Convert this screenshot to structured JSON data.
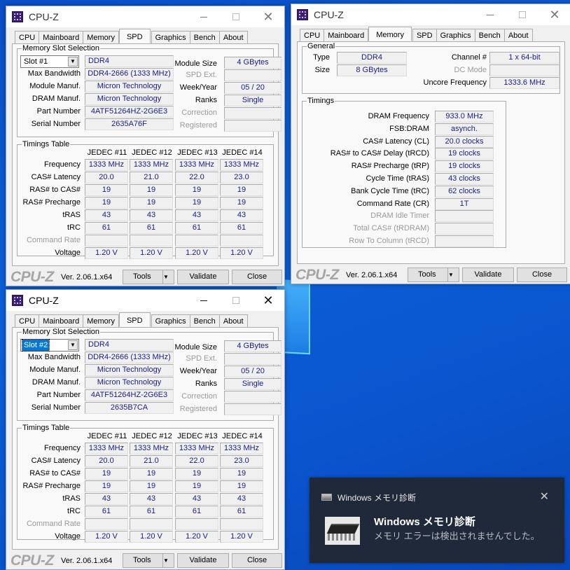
{
  "desktop": {
    "background_color": "#0b55cf"
  },
  "windows": [
    {
      "id": "spd1",
      "title": "CPU-Z",
      "active": false,
      "tabs": [
        "CPU",
        "Mainboard",
        "Memory",
        "SPD",
        "Graphics",
        "Bench",
        "About"
      ],
      "selected_tab": "SPD",
      "slot_group_label": "Memory Slot Selection",
      "slot": "Slot #1",
      "type": "DDR4",
      "labels": {
        "max_bandwidth": "Max Bandwidth",
        "module_manuf": "Module Manuf.",
        "dram_manuf": "DRAM Manuf.",
        "part_number": "Part Number",
        "serial_number": "Serial Number",
        "module_size": "Module Size",
        "spd_ext": "SPD Ext.",
        "week_year": "Week/Year",
        "ranks": "Ranks",
        "correction": "Correction",
        "registered": "Registered"
      },
      "values": {
        "max_bandwidth": "DDR4-2666 (1333 MHz)",
        "module_manuf": "Micron Technology",
        "dram_manuf": "Micron Technology",
        "part_number": "4ATF51264HZ-2G6E3",
        "serial_number": "2635A76F",
        "module_size": "4 GBytes",
        "spd_ext": "",
        "week_year": "05 / 20",
        "ranks": "Single",
        "correction": "",
        "registered": ""
      },
      "timings": {
        "group_label": "Timings Table",
        "columns": [
          "JEDEC #11",
          "JEDEC #12",
          "JEDEC #13",
          "JEDEC #14"
        ],
        "rows": [
          {
            "label": "Frequency",
            "dim": false,
            "values": [
              "1333 MHz",
              "1333 MHz",
              "1333 MHz",
              "1333 MHz"
            ]
          },
          {
            "label": "CAS# Latency",
            "dim": false,
            "values": [
              "20.0",
              "21.0",
              "22.0",
              "23.0"
            ]
          },
          {
            "label": "RAS# to CAS#",
            "dim": false,
            "values": [
              "19",
              "19",
              "19",
              "19"
            ]
          },
          {
            "label": "RAS# Precharge",
            "dim": false,
            "values": [
              "19",
              "19",
              "19",
              "19"
            ]
          },
          {
            "label": "tRAS",
            "dim": false,
            "values": [
              "43",
              "43",
              "43",
              "43"
            ]
          },
          {
            "label": "tRC",
            "dim": false,
            "values": [
              "61",
              "61",
              "61",
              "61"
            ]
          },
          {
            "label": "Command Rate",
            "dim": true,
            "values": [
              "",
              "",
              "",
              ""
            ]
          },
          {
            "label": "Voltage",
            "dim": false,
            "values": [
              "1.20 V",
              "1.20 V",
              "1.20 V",
              "1.20 V"
            ]
          }
        ]
      },
      "footer": {
        "brand": "CPU-Z",
        "version": "Ver. 2.06.1.x64",
        "tools": "Tools",
        "validate": "Validate",
        "close": "Close"
      }
    },
    {
      "id": "mem",
      "title": "CPU-Z",
      "active": false,
      "tabs": [
        "CPU",
        "Mainboard",
        "Memory",
        "SPD",
        "Graphics",
        "Bench",
        "About"
      ],
      "selected_tab": "Memory",
      "general": {
        "group_label": "General",
        "type_label": "Type",
        "type": "DDR4",
        "size_label": "Size",
        "size": "8 GBytes",
        "channel_label": "Channel #",
        "channel": "1 x 64-bit",
        "dc_mode_label": "DC Mode",
        "dc_mode": "",
        "uncore_label": "Uncore Frequency",
        "uncore": "1333.6 MHz"
      },
      "timings": {
        "group_label": "Timings",
        "rows": [
          {
            "label": "DRAM Frequency",
            "dim": false,
            "value": "933.0 MHz"
          },
          {
            "label": "FSB:DRAM",
            "dim": false,
            "value": "asynch."
          },
          {
            "label": "CAS# Latency (CL)",
            "dim": false,
            "value": "20.0 clocks"
          },
          {
            "label": "RAS# to CAS# Delay (tRCD)",
            "dim": false,
            "value": "19 clocks"
          },
          {
            "label": "RAS# Precharge (tRP)",
            "dim": false,
            "value": "19 clocks"
          },
          {
            "label": "Cycle Time (tRAS)",
            "dim": false,
            "value": "43 clocks"
          },
          {
            "label": "Bank Cycle Time (tRC)",
            "dim": false,
            "value": "62 clocks"
          },
          {
            "label": "Command Rate (CR)",
            "dim": false,
            "value": "1T"
          },
          {
            "label": "DRAM Idle Timer",
            "dim": true,
            "value": ""
          },
          {
            "label": "Total CAS# (tRDRAM)",
            "dim": true,
            "value": ""
          },
          {
            "label": "Row To Column (tRCD)",
            "dim": true,
            "value": ""
          }
        ]
      },
      "footer": {
        "brand": "CPU-Z",
        "version": "Ver. 2.06.1.x64",
        "tools": "Tools",
        "validate": "Validate",
        "close": "Close"
      }
    },
    {
      "id": "spd2",
      "title": "CPU-Z",
      "active": true,
      "tabs": [
        "CPU",
        "Mainboard",
        "Memory",
        "SPD",
        "Graphics",
        "Bench",
        "About"
      ],
      "selected_tab": "SPD",
      "slot_group_label": "Memory Slot Selection",
      "slot": "Slot #2",
      "type": "DDR4",
      "labels": {
        "max_bandwidth": "Max Bandwidth",
        "module_manuf": "Module Manuf.",
        "dram_manuf": "DRAM Manuf.",
        "part_number": "Part Number",
        "serial_number": "Serial Number",
        "module_size": "Module Size",
        "spd_ext": "SPD Ext.",
        "week_year": "Week/Year",
        "ranks": "Ranks",
        "correction": "Correction",
        "registered": "Registered"
      },
      "values": {
        "max_bandwidth": "DDR4-2666 (1333 MHz)",
        "module_manuf": "Micron Technology",
        "dram_manuf": "Micron Technology",
        "part_number": "4ATF51264HZ-2G6E3",
        "serial_number": "2635B7CA",
        "module_size": "4 GBytes",
        "spd_ext": "",
        "week_year": "05 / 20",
        "ranks": "Single",
        "correction": "",
        "registered": ""
      },
      "timings": {
        "group_label": "Timings Table",
        "columns": [
          "JEDEC #11",
          "JEDEC #12",
          "JEDEC #13",
          "JEDEC #14"
        ],
        "rows": [
          {
            "label": "Frequency",
            "dim": false,
            "values": [
              "1333 MHz",
              "1333 MHz",
              "1333 MHz",
              "1333 MHz"
            ]
          },
          {
            "label": "CAS# Latency",
            "dim": false,
            "values": [
              "20.0",
              "21.0",
              "22.0",
              "23.0"
            ]
          },
          {
            "label": "RAS# to CAS#",
            "dim": false,
            "values": [
              "19",
              "19",
              "19",
              "19"
            ]
          },
          {
            "label": "RAS# Precharge",
            "dim": false,
            "values": [
              "19",
              "19",
              "19",
              "19"
            ]
          },
          {
            "label": "tRAS",
            "dim": false,
            "values": [
              "43",
              "43",
              "43",
              "43"
            ]
          },
          {
            "label": "tRC",
            "dim": false,
            "values": [
              "61",
              "61",
              "61",
              "61"
            ]
          },
          {
            "label": "Command Rate",
            "dim": true,
            "values": [
              "",
              "",
              "",
              ""
            ]
          },
          {
            "label": "Voltage",
            "dim": false,
            "values": [
              "1.20 V",
              "1.20 V",
              "1.20 V",
              "1.20 V"
            ]
          }
        ]
      },
      "footer": {
        "brand": "CPU-Z",
        "version": "Ver. 2.06.1.x64",
        "tools": "Tools",
        "validate": "Validate",
        "close": "Close"
      }
    }
  ],
  "toast": {
    "app_name": "Windows メモリ診断",
    "title": "Windows メモリ診断",
    "message": "メモリ エラーは検出されませんでした。",
    "close_icon": "close-icon",
    "background_color": "#1f2939"
  }
}
